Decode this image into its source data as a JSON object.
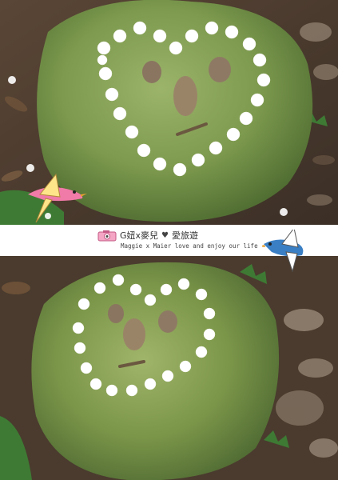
{
  "banner": {
    "author": "G妞x麥兒",
    "heart_glyph": "♥",
    "blog_name": "愛旅遊",
    "tagline": "Maggie x Maier love and enjoy our life"
  },
  "photos": [
    {
      "description": "Mossy boulder with a heart of white tung flowers and a pebble smiley face"
    },
    {
      "description": "Same mossy boulder viewed from farther away"
    }
  ],
  "colors": {
    "moss": "#7d9a4e",
    "flower": "#ffffff",
    "pink_bird": "#f07aa8",
    "blue_bird": "#3a7fc4"
  }
}
